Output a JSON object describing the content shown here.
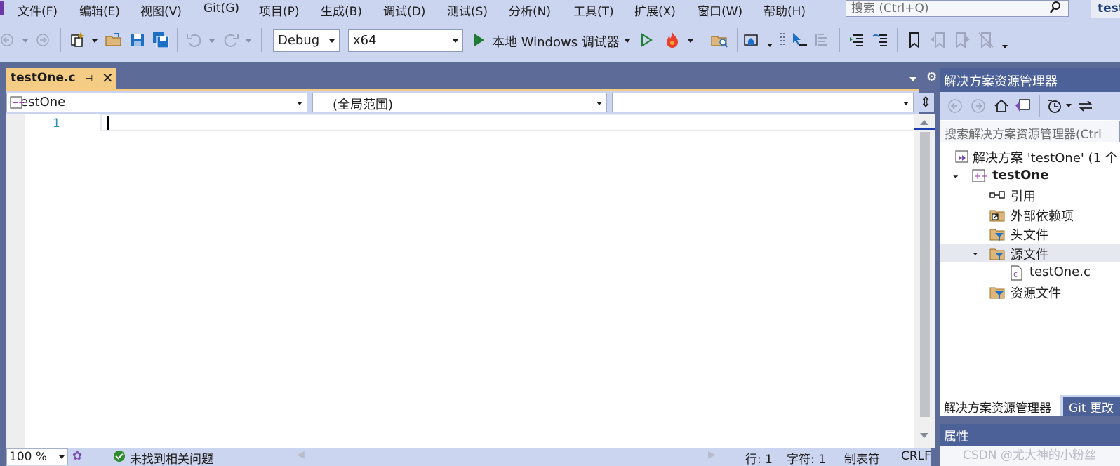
{
  "menu": {
    "items": [
      "文件(F)",
      "编辑(E)",
      "视图(V)",
      "Git(G)",
      "项目(P)",
      "生成(B)",
      "调试(D)",
      "测试(S)",
      "分析(N)",
      "工具(T)",
      "扩展(X)",
      "窗口(W)",
      "帮助(H)"
    ],
    "search_placeholder": "搜索 (Ctrl+Q)",
    "title_fragment": "test"
  },
  "toolbar": {
    "configuration": "Debug",
    "platform": "x64",
    "debugger_label": "本地 Windows 调试器"
  },
  "document": {
    "tab_name": "testOne.c",
    "nav_project": "testOne",
    "nav_scope": "(全局范围)",
    "nav_member": "",
    "line_number": "1"
  },
  "status": {
    "zoom": "100 %",
    "issues": "未找到相关问题",
    "line": "行: 1",
    "char": "字符: 1",
    "tab_mode": "制表符",
    "line_ending": "CRLF"
  },
  "solution_explorer": {
    "title": "解决方案资源管理器",
    "search_placeholder": "搜索解决方案资源管理器(Ctrl",
    "tree": {
      "solution": "解决方案 'testOne' (1 个",
      "project": "testOne",
      "references": "引用",
      "external_deps": "外部依赖项",
      "headers": "头文件",
      "sources": "源文件",
      "source_file": "testOne.c",
      "resources": "资源文件"
    },
    "tab_active": "解决方案资源管理器",
    "tab_inactive": "Git 更改"
  },
  "properties": {
    "title": "属性"
  },
  "watermark": "CSDN @尤大神的小粉丝",
  "colors": {
    "accent": "#4d6199",
    "chrome": "#ccd5f0",
    "tab_active": "#f5cc84",
    "line_number": "#2b91af"
  }
}
